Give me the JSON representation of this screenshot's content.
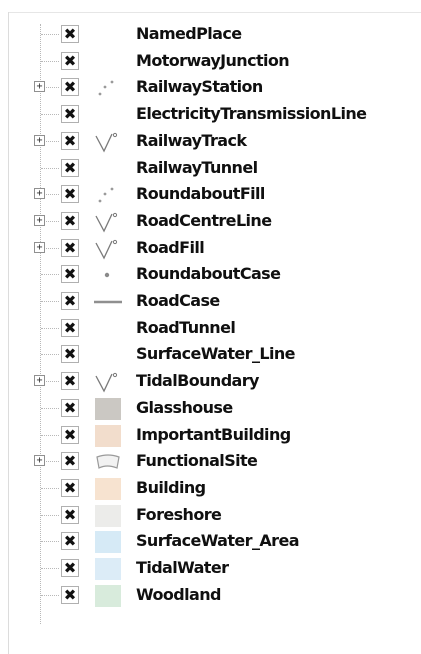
{
  "layers": [
    {
      "name": "NamedPlace",
      "expandable": false,
      "checked": true,
      "symbol": "none"
    },
    {
      "name": "MotorwayJunction",
      "expandable": false,
      "checked": true,
      "symbol": "none"
    },
    {
      "name": "RailwayStation",
      "expandable": true,
      "checked": true,
      "symbol": "points-icon"
    },
    {
      "name": "ElectricityTransmissionLine",
      "expandable": false,
      "checked": true,
      "symbol": "none"
    },
    {
      "name": "RailwayTrack",
      "expandable": true,
      "checked": true,
      "symbol": "line-categories-icon"
    },
    {
      "name": "RailwayTunnel",
      "expandable": false,
      "checked": true,
      "symbol": "none"
    },
    {
      "name": "RoundaboutFill",
      "expandable": true,
      "checked": true,
      "symbol": "points-icon"
    },
    {
      "name": "RoadCentreLine",
      "expandable": true,
      "checked": true,
      "symbol": "line-categories-icon"
    },
    {
      "name": "RoadFill",
      "expandable": true,
      "checked": true,
      "symbol": "line-categories-icon"
    },
    {
      "name": "RoundaboutCase",
      "expandable": false,
      "checked": true,
      "symbol": "dot-icon"
    },
    {
      "name": "RoadCase",
      "expandable": false,
      "checked": true,
      "symbol": "line-icon"
    },
    {
      "name": "RoadTunnel",
      "expandable": false,
      "checked": true,
      "symbol": "none"
    },
    {
      "name": "SurfaceWater_Line",
      "expandable": false,
      "checked": true,
      "symbol": "none"
    },
    {
      "name": "TidalBoundary",
      "expandable": true,
      "checked": true,
      "symbol": "line-categories-icon"
    },
    {
      "name": "Glasshouse",
      "expandable": false,
      "checked": true,
      "symbol": "fill-swatch",
      "color": "#cbc8c3"
    },
    {
      "name": "ImportantBuilding",
      "expandable": false,
      "checked": true,
      "symbol": "fill-swatch",
      "color": "#f2ddcc"
    },
    {
      "name": "FunctionalSite",
      "expandable": true,
      "checked": true,
      "symbol": "polygon-categories-icon"
    },
    {
      "name": "Building",
      "expandable": false,
      "checked": true,
      "symbol": "fill-swatch",
      "color": "#f7e3d0"
    },
    {
      "name": "Foreshore",
      "expandable": false,
      "checked": true,
      "symbol": "fill-swatch",
      "color": "#ececea"
    },
    {
      "name": "SurfaceWater_Area",
      "expandable": false,
      "checked": true,
      "symbol": "fill-swatch",
      "color": "#d6eaf6"
    },
    {
      "name": "TidalWater",
      "expandable": false,
      "checked": true,
      "symbol": "fill-swatch",
      "color": "#dcecf7"
    },
    {
      "name": "Woodland",
      "expandable": false,
      "checked": true,
      "symbol": "fill-swatch",
      "color": "#d8ebdc"
    }
  ],
  "icons": {
    "expander": "⊞",
    "checkbox_mark": "✖"
  }
}
